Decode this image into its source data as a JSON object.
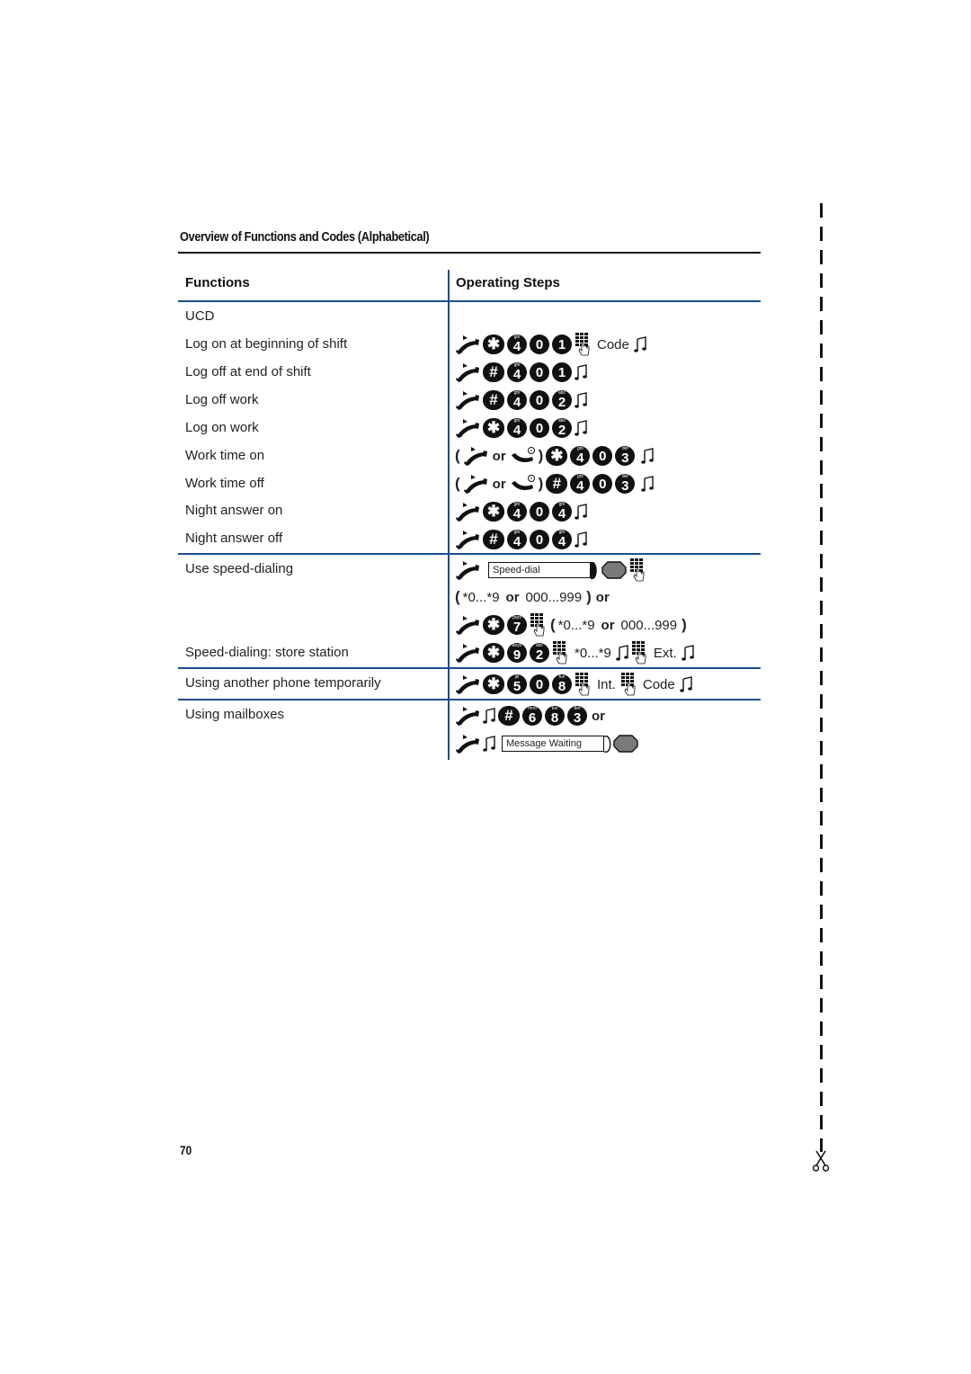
{
  "section_title": "Overview of Functions and Codes (Alphabetical)",
  "table": {
    "headers": {
      "functions": "Functions",
      "steps": "Operating Steps"
    },
    "functions": [
      "UCD",
      "Log on at beginning of shift",
      "Log off at end of shift",
      "Log off work",
      "Log on work",
      "Work time on",
      "Work time off",
      "Night answer on",
      "Night answer off",
      "Use speed-dialing",
      "Speed-dialing: store station",
      "Using another phone temporarily",
      "Using mailboxes"
    ],
    "keys": {
      "star": "✱",
      "hash": "#",
      "k0": "0",
      "k1": "1",
      "k2": "2",
      "k3": "3",
      "k4": "4",
      "k5": "5",
      "k6": "6",
      "k7": "7",
      "k8": "8",
      "k9": "9",
      "l2": "abc",
      "l3": "def",
      "l4": "ghi",
      "l5": "jkl",
      "l6": "mno",
      "l7": "pqrs",
      "l8": "tuv",
      "l9": "wxyz"
    },
    "labels": {
      "code": "Code",
      "or": "or",
      "ext": "Ext.",
      "int": "Int.",
      "open_paren": "(",
      "close_paren": ")",
      "speed_dial_display": "Speed-dial",
      "message_waiting_display": "Message Waiting",
      "range_star": "*0...*9",
      "range_num": "000...999",
      "range_star_only": "*0...*9"
    }
  },
  "icons": {
    "lift_handset": "lift-handset-icon",
    "handset_ringing": "handset-ringing-icon",
    "keypad": "keypad-entry-icon",
    "confirmation_tone": "confirmation-tone-icon",
    "display_key": "display-key-icon",
    "scissors": "scissors-icon"
  },
  "page_number": "70",
  "colors": {
    "rule_blue": "#1a4e8a",
    "text": "#222222"
  }
}
